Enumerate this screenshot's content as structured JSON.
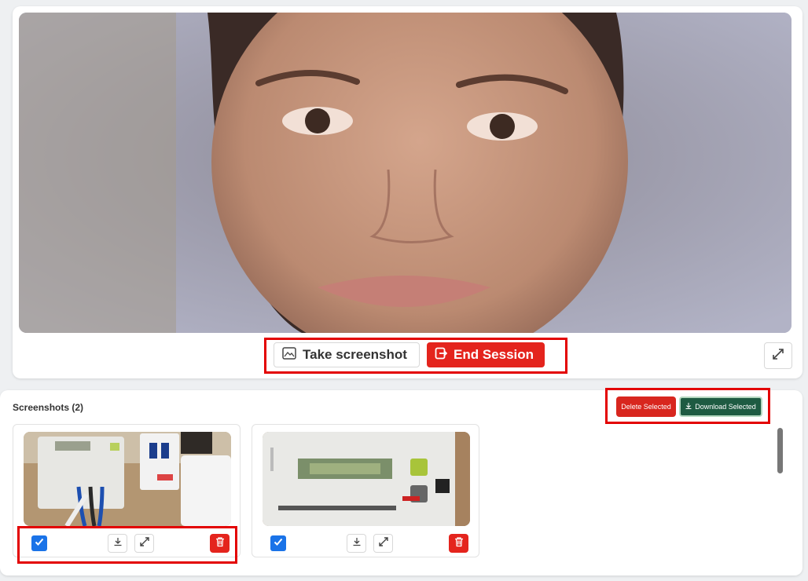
{
  "video": {
    "take_screenshot_label": "Take screenshot",
    "end_session_label": "End Session"
  },
  "screenshots": {
    "title": "Screenshots (2)",
    "delete_selected_label": "Delete Selected",
    "download_selected_label": "Download Selected",
    "items": [
      {
        "checked": true
      },
      {
        "checked": true
      }
    ]
  },
  "colors": {
    "accent_red": "#e4241d",
    "download_green": "#1e5b42",
    "checkbox_blue": "#1a73e8",
    "highlight_red": "#e30000"
  },
  "icons": {
    "screenshot": "image-icon",
    "end_session": "exit-icon",
    "fullscreen": "expand-icon",
    "download": "download-icon",
    "expand": "expand-icon",
    "delete": "trash-icon",
    "check": "check-icon"
  }
}
